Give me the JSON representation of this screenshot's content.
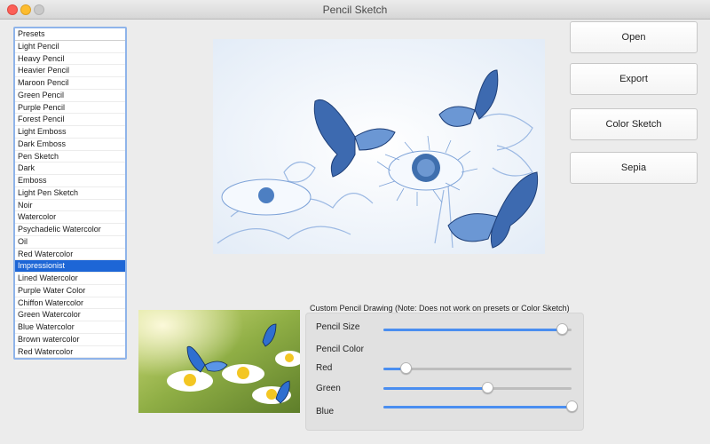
{
  "window": {
    "title": "Pencil Sketch"
  },
  "presets": {
    "header": "Presets",
    "items": [
      "Light Pencil",
      "Heavy Pencil",
      "Heavier Pencil",
      "Maroon Pencil",
      "Green Pencil",
      "Purple Pencil",
      "Forest Pencil",
      "Light Emboss",
      "Dark Emboss",
      "Pen Sketch",
      "Dark",
      "Emboss",
      "Light Pen Sketch",
      "Noir",
      "Watercolor",
      "Psychadelic Watercolor",
      "Oil",
      "Red Watercolor",
      "Impressionist",
      "Lined Watercolor",
      "Purple Water Color",
      "Chiffon Watercolor",
      "Green Watercolor",
      "Blue Watercolor",
      "Brown watercolor",
      "Red Watercolor"
    ],
    "selected_index": 18
  },
  "buttons": {
    "open": "Open",
    "export": "Export",
    "color_sketch": "Color Sketch",
    "sepia": "Sepia"
  },
  "custom": {
    "heading": "Custom Pencil Drawing (Note: Does not work on presets or Color Sketch)",
    "pencil_size_label": "Pencil Size",
    "pencil_color_label": "Pencil Color",
    "red_label": "Red",
    "green_label": "Green",
    "blue_label": "Blue",
    "pencil_size_value": 0.95,
    "red_value": 0.12,
    "green_value": 0.55,
    "blue_value": 1.0
  },
  "colors": {
    "accent": "#1d66d6",
    "slider_fill": "#4a8ef0",
    "sketch_blue": "#5b8ed6"
  }
}
